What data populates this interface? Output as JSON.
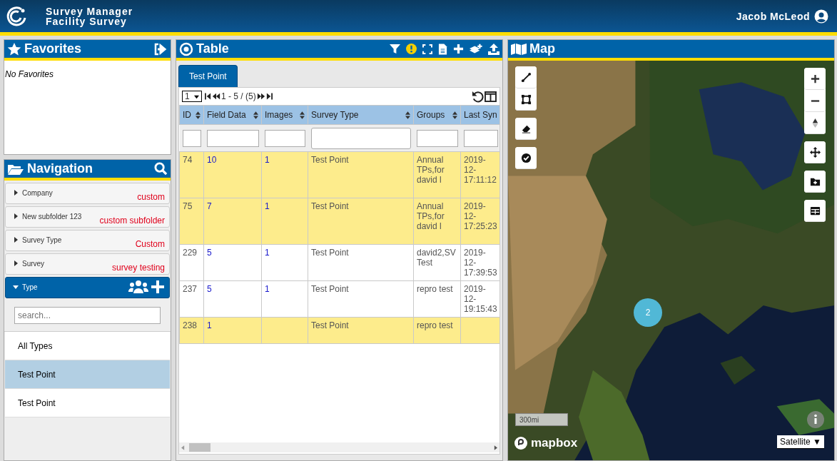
{
  "header": {
    "app_title": "Survey Manager",
    "subtitle": "Facility Survey",
    "user": "Jacob McLeod"
  },
  "favorites": {
    "title": "Favorites",
    "empty_text": "No Favorites"
  },
  "navigation": {
    "title": "Navigation",
    "items": [
      {
        "label": "Company",
        "value": "custom",
        "expanded": false
      },
      {
        "label": "New subfolder 123",
        "value": "custom subfolder",
        "expanded": false
      },
      {
        "label": "Survey Type",
        "value": "Custom",
        "expanded": false
      },
      {
        "label": "Survey",
        "value": "survey testing",
        "expanded": false
      },
      {
        "label": "Type",
        "expanded": true
      }
    ],
    "search": {
      "placeholder": "search..."
    },
    "types": [
      {
        "label": "All Types",
        "selected": false
      },
      {
        "label": "Test Point",
        "selected": true
      },
      {
        "label": "Test Point",
        "selected": false
      }
    ]
  },
  "table": {
    "title": "Table",
    "tabs": [
      {
        "label": "Test Point",
        "selected": true
      }
    ],
    "page": "1",
    "range": "1 - 5 / (5)",
    "columns": [
      "ID",
      "Field Data",
      "Images",
      "Survey Type",
      "Groups",
      "Last Syn"
    ],
    "rows": [
      {
        "highlighted": true,
        "cells": [
          "74",
          "10",
          "1",
          "Test Point",
          "Annual TPs,for david l",
          "2019-12- 17:11:12"
        ]
      },
      {
        "highlighted": true,
        "cells": [
          "75",
          "7",
          "1",
          "Test Point",
          "Annual TPs,for david l",
          "2019-12- 17:25:23"
        ]
      },
      {
        "highlighted": false,
        "cells": [
          "229",
          "5",
          "1",
          "Test Point",
          "david2,SV Test",
          "2019-12- 17:39:53"
        ]
      },
      {
        "highlighted": false,
        "cells": [
          "237",
          "5",
          "1",
          "Test Point",
          "repro test",
          "2019-12- 19:15:43"
        ]
      },
      {
        "highlighted": true,
        "cells": [
          "238",
          "1",
          "",
          "Test Point",
          "repro test",
          ""
        ]
      }
    ]
  },
  "map": {
    "title": "Map",
    "cluster": "2",
    "scale": "300mi",
    "logo": "mapbox",
    "style": "Satellite ▼"
  }
}
